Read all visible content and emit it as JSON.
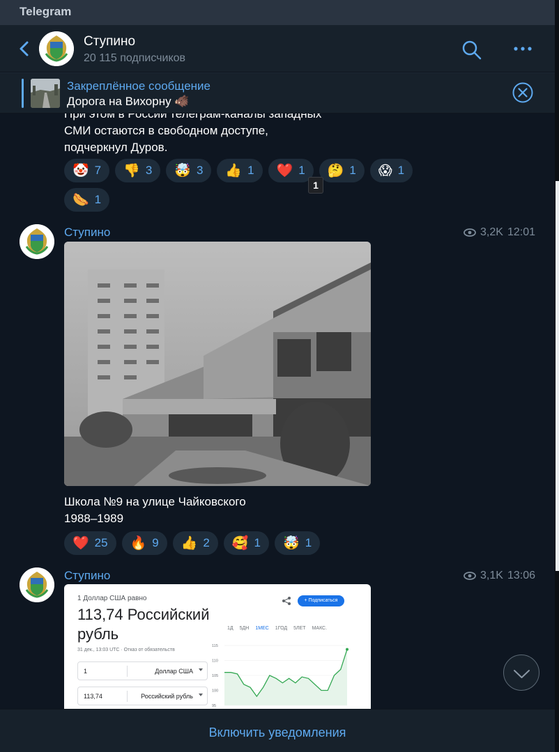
{
  "window": {
    "app_name": "Telegram"
  },
  "channel": {
    "name": "Ступино",
    "subscribers": "20 115 подписчиков"
  },
  "pinned": {
    "title": "Закреплённое сообщение",
    "text": "Дорога на Вихорну 🐗"
  },
  "messages": [
    {
      "text_lines": [
        "При этом в России телеграм-каналы западных",
        "СМИ остаются в свободном доступе,",
        "подчеркнул Дуров."
      ],
      "reactions": [
        {
          "emoji": "🤡",
          "count": "7"
        },
        {
          "emoji": "👎",
          "count": "3"
        },
        {
          "emoji": "🤯",
          "count": "3"
        },
        {
          "emoji": "👍",
          "count": "1"
        },
        {
          "emoji": "❤️",
          "count": "1"
        },
        {
          "emoji": "🤔",
          "count": "1"
        },
        {
          "emoji": "😱",
          "count": "1"
        },
        {
          "emoji": "🌭",
          "count": "1"
        }
      ],
      "tooltip": "1"
    },
    {
      "sender": "Ступино",
      "views": "3,2K",
      "time": "12:01",
      "caption_lines": [
        "Школа №9 на улице Чайковского",
        "1988–1989"
      ],
      "reactions": [
        {
          "emoji": "❤️",
          "count": "25"
        },
        {
          "emoji": "🔥",
          "count": "9"
        },
        {
          "emoji": "👍",
          "count": "2"
        },
        {
          "emoji": "🥰",
          "count": "1"
        },
        {
          "emoji": "🤯",
          "count": "1"
        }
      ]
    },
    {
      "sender": "Ступино",
      "views": "3,1K",
      "time": "13:06",
      "screenshot": {
        "caption": "1 Доллар США равно",
        "rate": "113,74 Российский рубль",
        "date": "31 дек., 13:03 UTC · Отказ от обязательств",
        "subscribe": "+ Подписаться",
        "ranges": [
          "1Д",
          "5ДН",
          "1МЕС",
          "1ГОД",
          "5ЛЕТ",
          "МАКС."
        ],
        "selected_range": "1МЕС",
        "field1": {
          "value": "1",
          "unit": "Доллар США"
        },
        "field2": {
          "value": "113,74",
          "unit": "Российский рубль"
        },
        "y_ticks": [
          "115",
          "110",
          "105",
          "100",
          "95"
        ]
      }
    }
  ],
  "footer": {
    "notify_label": "Включить уведомления"
  },
  "colors": {
    "accent": "#5ea9ef",
    "background": "#0e1621",
    "panel": "#17212b"
  },
  "chart_data": {
    "type": "line",
    "title": "",
    "xlabel": "",
    "ylabel": "",
    "ylim": [
      95,
      115
    ],
    "series": [
      {
        "values": [
          106,
          106,
          105.5,
          102,
          101,
          98,
          101,
          105,
          104,
          102.5,
          104,
          102.5,
          104.5,
          104,
          102,
          100,
          100,
          105,
          107,
          113.7
        ]
      }
    ]
  }
}
